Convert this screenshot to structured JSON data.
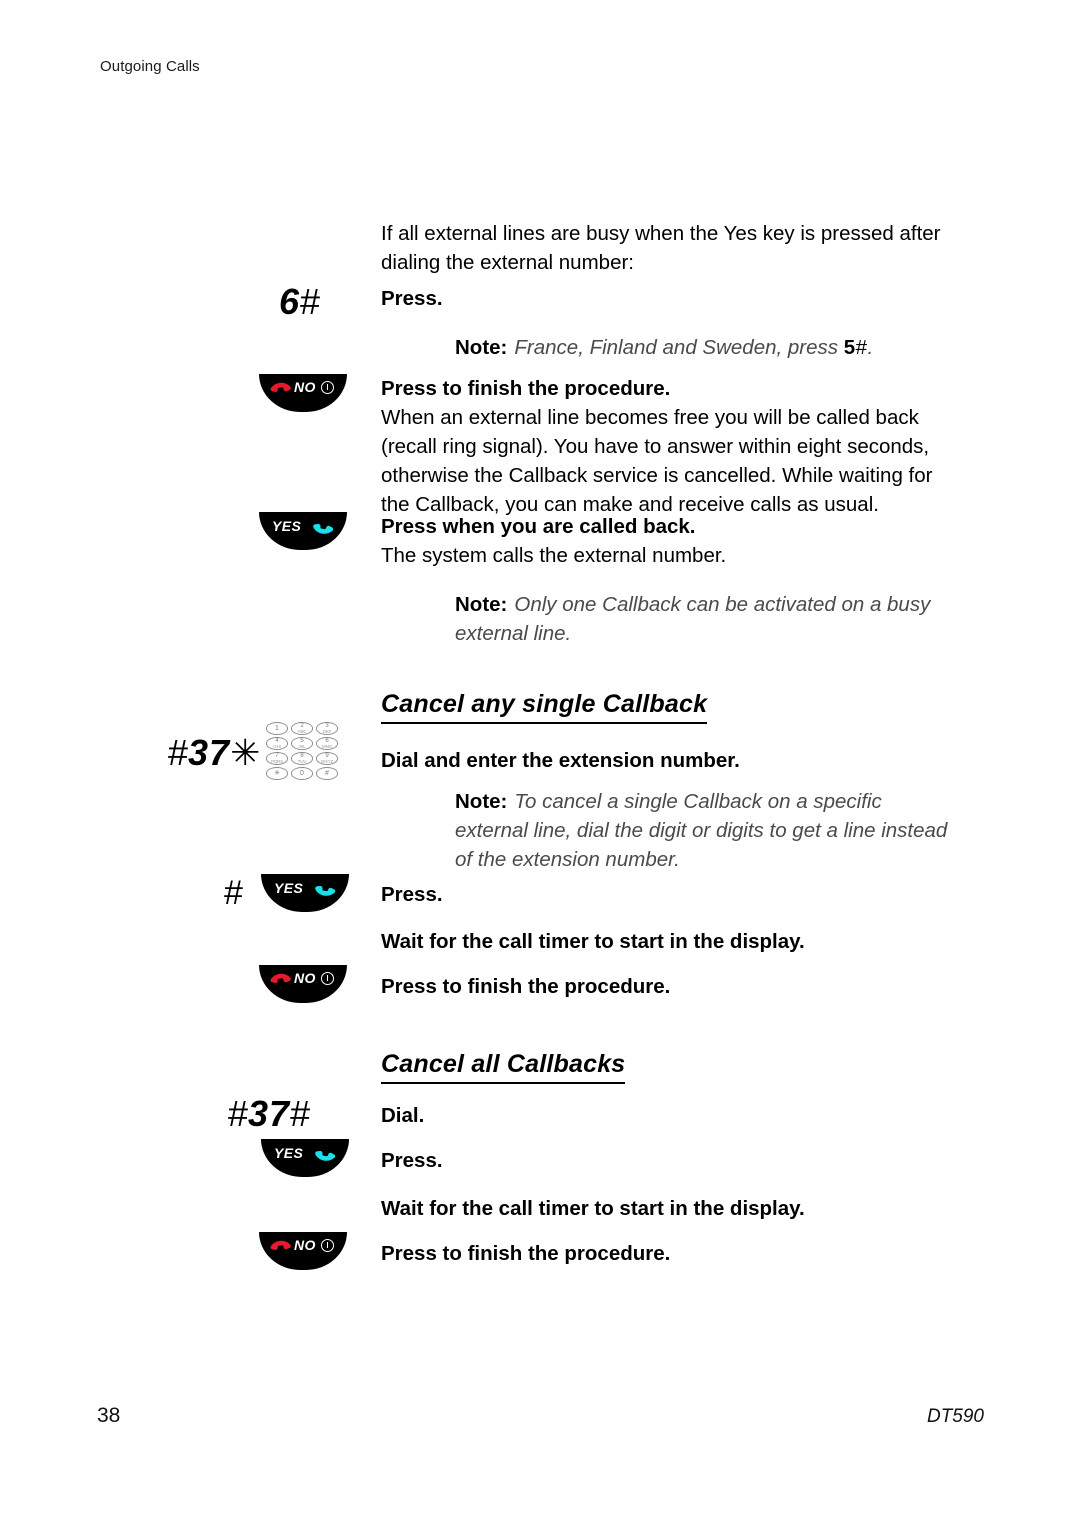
{
  "page": {
    "running_head": "Outgoing Calls",
    "page_number": "38",
    "document_name": "DT590"
  },
  "intro": {
    "text": "If all external lines are busy when the Yes key is pressed after dialing the external number:"
  },
  "steps": [
    {
      "key_type": "dialcode",
      "code_digits": "6",
      "code_symbol": "#",
      "instruction": "Press.",
      "note_label": "Note:",
      "note_text": "France, Finland and Sweden, press ",
      "note_code_digits": "5",
      "note_code_symbol": "#",
      "note_suffix": "."
    },
    {
      "key_type": "no",
      "instruction": "Press to finish the procedure.",
      "body": "When an external line becomes free you will be called back (recall ring signal). You have to answer within eight seconds, otherwise the Callback service is cancelled. While waiting for the Callback, you can make and receive calls as usual."
    },
    {
      "key_type": "yes",
      "instruction": "Press when you are called back.",
      "body": "The system calls the external number.",
      "note_label": "Note:",
      "note_text": "Only one Callback can be activated on a busy external line."
    }
  ],
  "section_single": {
    "heading": "Cancel any single Callback",
    "dial": {
      "prefix_symbol": "#",
      "digits": "37",
      "suffix_symbol": "✳"
    },
    "instruction": "Dial and enter the extension number.",
    "note_label": "Note:",
    "note_text": "To cancel a single Callback on a specific external line, dial the digit or digits to get a line instead of the extension number.",
    "press_symbol": "#",
    "press_instruction": "Press.",
    "wait_instruction": "Wait for the call timer to start in the display.",
    "finish_instruction": "Press to finish the procedure."
  },
  "section_all": {
    "heading": "Cancel all Callbacks",
    "dial": {
      "prefix_symbol": "#",
      "digits": "37",
      "suffix_symbol": "#"
    },
    "dial_instruction": "Dial.",
    "press_instruction": "Press.",
    "wait_instruction": "Wait for the call timer to start in the display.",
    "finish_instruction": "Press to finish the procedure."
  },
  "softkeys": {
    "yes_label": "YES",
    "no_label": "NO"
  },
  "keypad": {
    "keys": [
      {
        "num": "1",
        "letters": ""
      },
      {
        "num": "2",
        "letters": "ABC"
      },
      {
        "num": "3",
        "letters": "DEF"
      },
      {
        "num": "4",
        "letters": "GHI"
      },
      {
        "num": "5",
        "letters": "JKL"
      },
      {
        "num": "6",
        "letters": "MNO"
      },
      {
        "num": "7",
        "letters": "PQRS"
      },
      {
        "num": "8",
        "letters": "TUV"
      },
      {
        "num": "9",
        "letters": "WXYZ"
      },
      {
        "num": "✳",
        "letters": ""
      },
      {
        "num": "0",
        "letters": ""
      },
      {
        "num": "#",
        "letters": ""
      }
    ]
  },
  "colors": {
    "yes_handset": "#19E0E8",
    "no_handset": "#E8192B",
    "softkey_body": "#000000",
    "note_text": "#4a4a4a"
  }
}
